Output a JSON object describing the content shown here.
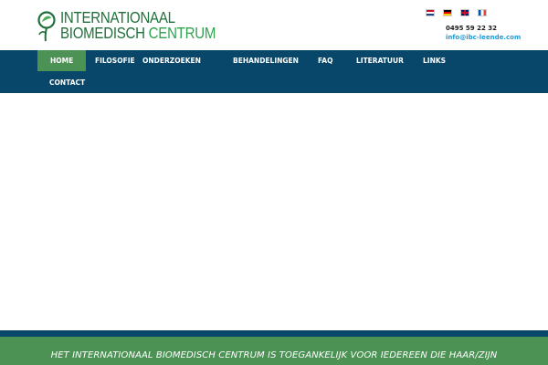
{
  "header": {
    "logo": {
      "line1": "INTERNATIONAAL",
      "line2_a": "BIOMEDISCH",
      "line2_b": "CENTRUM"
    },
    "languages": [
      {
        "code": "nl",
        "icon": "flag-nl-icon"
      },
      {
        "code": "de",
        "icon": "flag-de-icon"
      },
      {
        "code": "en",
        "icon": "flag-gb-icon"
      },
      {
        "code": "fr",
        "icon": "flag-fr-icon"
      }
    ],
    "phone": "0495 59 22 32",
    "email": "info@ibc-leende.com"
  },
  "nav": {
    "items": [
      {
        "label": "Home",
        "active": true
      },
      {
        "label": "Filosofie"
      },
      {
        "label": "Onderzoeken"
      },
      {
        "label": "Behandelingen"
      },
      {
        "label": "FAQ"
      },
      {
        "label": "Literatuur"
      },
      {
        "label": "Links"
      },
      {
        "label": "Contact"
      }
    ]
  },
  "footer": {
    "banner_text": "HET INTERNATIONAAL BIOMEDISCH CENTRUM IS TOEGANKELIJK VOOR IEDEREEN DIE HAAR/ZIJN"
  },
  "colors": {
    "nav_bg": "#08476a",
    "accent_green": "#4c9255",
    "logo_green": "#1f6f3a",
    "link_blue": "#1e9ad6"
  }
}
